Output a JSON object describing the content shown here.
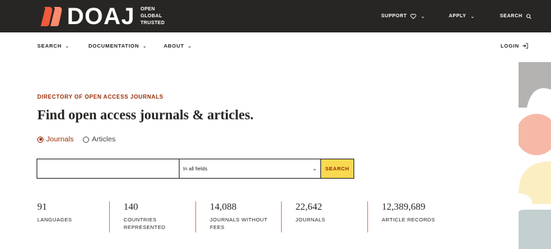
{
  "logo": {
    "wordmark": "DOAJ",
    "tagline": [
      "OPEN",
      "GLOBAL",
      "TRUSTED"
    ],
    "icon": "doaj-logo-icon"
  },
  "topnav": {
    "support": "SUPPORT",
    "apply": "APPLY",
    "search": "SEARCH"
  },
  "subnav": {
    "search": "SEARCH",
    "documentation": "DOCUMENTATION",
    "about": "ABOUT",
    "login": "LOGIN"
  },
  "main": {
    "eyebrow": "DIRECTORY OF OPEN ACCESS JOURNALS",
    "heading": "Find open access journals & articles.",
    "radios": [
      {
        "label": "Journals",
        "checked": true
      },
      {
        "label": "Articles",
        "checked": false
      }
    ],
    "search": {
      "value": "",
      "placeholder": "",
      "field_select": "In all fields",
      "button": "SEARCH"
    }
  },
  "stats": [
    {
      "value": "91",
      "label": [
        "LANGUAGES"
      ]
    },
    {
      "value": "140",
      "label": [
        "COUNTRIES",
        "REPRESENTED"
      ]
    },
    {
      "value": "14,088",
      "label": [
        "JOURNALS WITHOUT",
        "FEES"
      ]
    },
    {
      "value": "22,642",
      "label": [
        "JOURNALS"
      ]
    },
    {
      "value": "12,389,689",
      "label": [
        "ARTICLE RECORDS"
      ]
    }
  ],
  "colors": {
    "topbar_bg": "#282624",
    "accent": "#982e0a",
    "button_yellow": "#f9d950",
    "divider": "#e2785c",
    "logo_orange": "#f15a3c"
  }
}
